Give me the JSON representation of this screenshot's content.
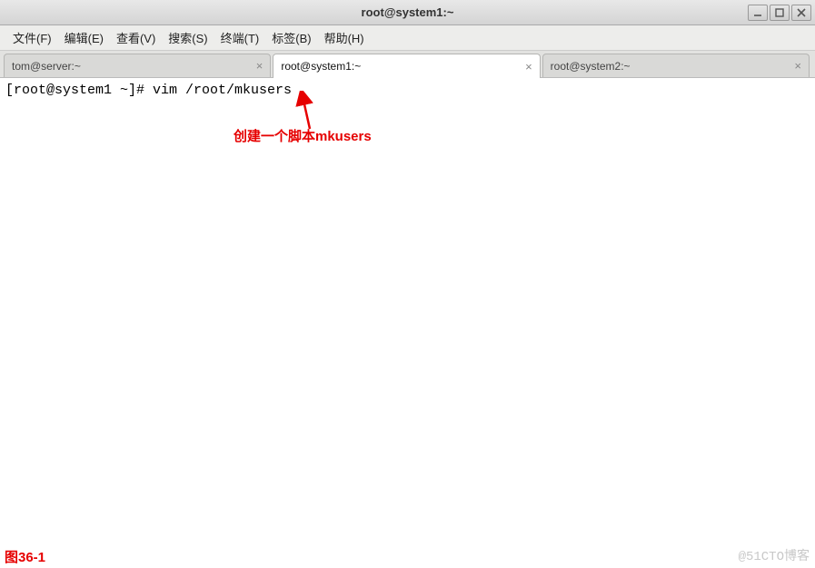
{
  "window": {
    "title": "root@system1:~"
  },
  "menu": {
    "file": "文件(F)",
    "edit": "编辑(E)",
    "view": "查看(V)",
    "search": "搜索(S)",
    "terminal": "终端(T)",
    "tabs": "标签(B)",
    "help": "帮助(H)"
  },
  "tabs": [
    {
      "label": "tom@server:~"
    },
    {
      "label": "root@system1:~"
    },
    {
      "label": "root@system2:~"
    }
  ],
  "terminal": {
    "line1": "[root@system1 ~]# vim /root/mkusers"
  },
  "annotation": {
    "text": "创建一个脚本mkusers",
    "arrow_color": "#e60000"
  },
  "figure_label": "图36-1",
  "watermark": "@51CTO博客"
}
